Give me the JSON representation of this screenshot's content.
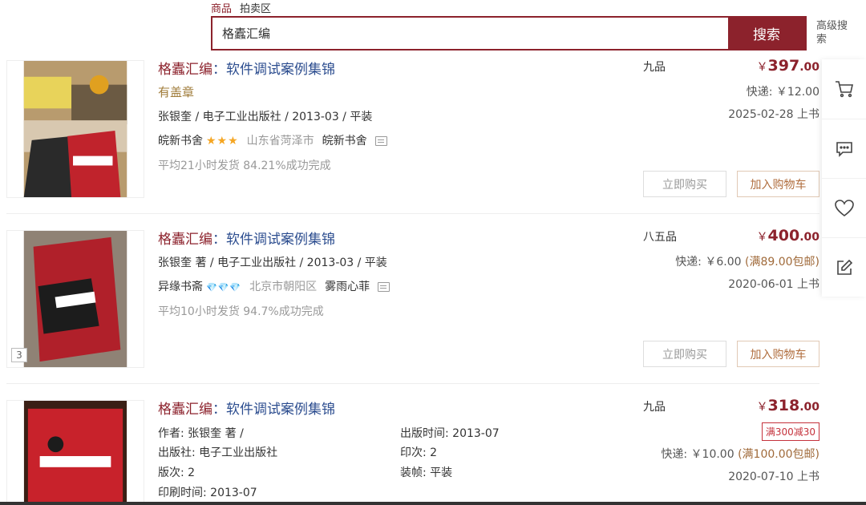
{
  "search": {
    "tabs": [
      "商品",
      "拍卖区"
    ],
    "query": "格蠹汇编",
    "button": "搜索",
    "advanced": "高级搜索"
  },
  "items": [
    {
      "title_kw": "格蠹汇编",
      "title_rest": "：软件调试案例集锦",
      "stamp": "有盖章",
      "meta": "张银奎 / 电子工业出版社 / 2013-03 / 平装",
      "shop": "皖新书舍",
      "rating": "★★★",
      "location": "山东省菏泽市",
      "seller": "皖新书舍",
      "stats": "平均21小时发货  84.21%成功完成",
      "condition": "九品",
      "price_int": "397",
      "price_dec": ".00",
      "shipping": "快递: ￥12.00",
      "listed": "2025-02-28 上书",
      "buy": "立即购买",
      "cart": "加入购物车"
    },
    {
      "title_kw": "格蠹汇编",
      "title_rest": "：软件调试案例集锦",
      "meta": "张银奎 著 / 电子工业出版社 / 2013-03 / 平装",
      "shop": "异缘书斋",
      "rating": "💎💎💎",
      "location": "北京市朝阳区",
      "seller": "雾雨心菲",
      "stats": "平均10小时发货  94.7%成功完成",
      "img_count": "3",
      "condition": "八五品",
      "price_int": "400",
      "price_dec": ".00",
      "shipping": "快递: ￥6.00 ",
      "free_ship": "(满89.00包邮)",
      "listed": "2020-06-01 上书",
      "buy": "立即购买",
      "cart": "加入购物车"
    },
    {
      "title_kw": "格蠹汇编",
      "title_rest": "：软件调试案例集锦",
      "author": "作者: 张银奎 著 /",
      "publisher": "出版社: 电子工业出版社",
      "edition": "版次: 2",
      "print_time": "印刷时间: 2013-07",
      "pub_time": "出版时间: 2013-07",
      "printing": "印次: 2",
      "binding": "装帧: 平装",
      "condition": "九品",
      "price_int": "318",
      "price_dec": ".00",
      "promo": "满300减30",
      "shipping": "快递: ￥10.00 ",
      "free_ship": "(满100.00包邮)",
      "listed": "2020-07-10 上书"
    }
  ],
  "currency": "￥",
  "colors": {
    "brand": "#8c222c",
    "link": "#2c4d8f",
    "star": "#f5a623",
    "diamond": "#4ab4f0"
  },
  "sidebar_icons": [
    "cart-icon",
    "message-icon",
    "heart-icon",
    "edit-icon"
  ]
}
